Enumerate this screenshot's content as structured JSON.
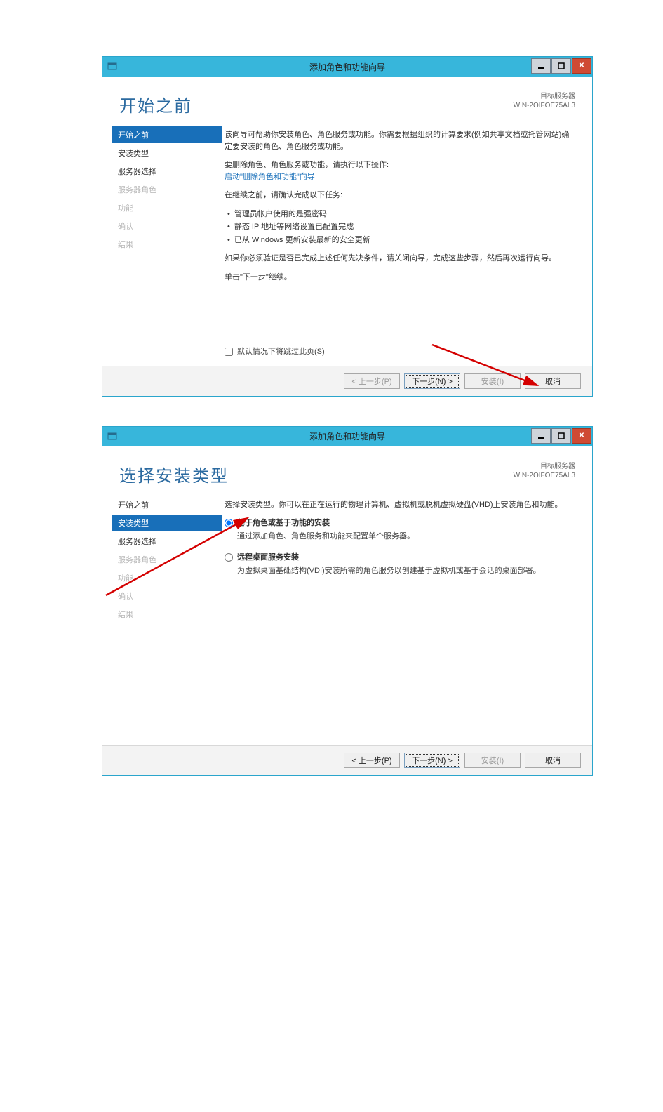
{
  "window1": {
    "title": "添加角色和功能向导",
    "heading": "开始之前",
    "target_label": "目标服务器",
    "target_value": "WIN-2OIFOE75AL3",
    "sidebar": [
      {
        "label": "开始之前",
        "state": "active"
      },
      {
        "label": "安装类型",
        "state": "normal"
      },
      {
        "label": "服务器选择",
        "state": "normal"
      },
      {
        "label": "服务器角色",
        "state": "disabled"
      },
      {
        "label": "功能",
        "state": "disabled"
      },
      {
        "label": "确认",
        "state": "disabled"
      },
      {
        "label": "结果",
        "state": "disabled"
      }
    ],
    "p1": "该向导可帮助你安装角色、角色服务或功能。你需要根据组织的计算要求(例如共享文档或托管网站)确定要安装的角色、角色服务或功能。",
    "p2a": "要删除角色、角色服务或功能，请执行以下操作:",
    "p2b": "启动\"删除角色和功能\"向导",
    "p3": "在继续之前，请确认完成以下任务:",
    "bullets": [
      "管理员帐户使用的是强密码",
      "静态 IP 地址等网络设置已配置完成",
      "已从 Windows 更新安装最新的安全更新"
    ],
    "p4": "如果你必须验证是否已完成上述任何先决条件，请关闭向导，完成这些步骤，然后再次运行向导。",
    "p5": "单击\"下一步\"继续。",
    "skip": "默认情况下将跳过此页(S)",
    "buttons": {
      "prev": "< 上一步(P)",
      "next": "下一步(N) >",
      "install": "安装(I)",
      "cancel": "取消"
    }
  },
  "window2": {
    "title": "添加角色和功能向导",
    "heading": "选择安装类型",
    "target_label": "目标服务器",
    "target_value": "WIN-2OIFOE75AL3",
    "sidebar": [
      {
        "label": "开始之前",
        "state": "normal"
      },
      {
        "label": "安装类型",
        "state": "active"
      },
      {
        "label": "服务器选择",
        "state": "normal"
      },
      {
        "label": "服务器角色",
        "state": "disabled"
      },
      {
        "label": "功能",
        "state": "disabled"
      },
      {
        "label": "确认",
        "state": "disabled"
      },
      {
        "label": "结果",
        "state": "disabled"
      }
    ],
    "intro": "选择安装类型。你可以在正在运行的物理计算机、虚拟机或脱机虚拟硬盘(VHD)上安装角色和功能。",
    "opt1_title": "基于角色或基于功能的安装",
    "opt1_desc": "通过添加角色、角色服务和功能来配置单个服务器。",
    "opt2_title": "远程桌面服务安装",
    "opt2_desc": "为虚拟桌面基础结构(VDI)安装所需的角色服务以创建基于虚拟机或基于会话的桌面部署。",
    "buttons": {
      "prev": "< 上一步(P)",
      "next": "下一步(N) >",
      "install": "安装(I)",
      "cancel": "取消"
    }
  }
}
